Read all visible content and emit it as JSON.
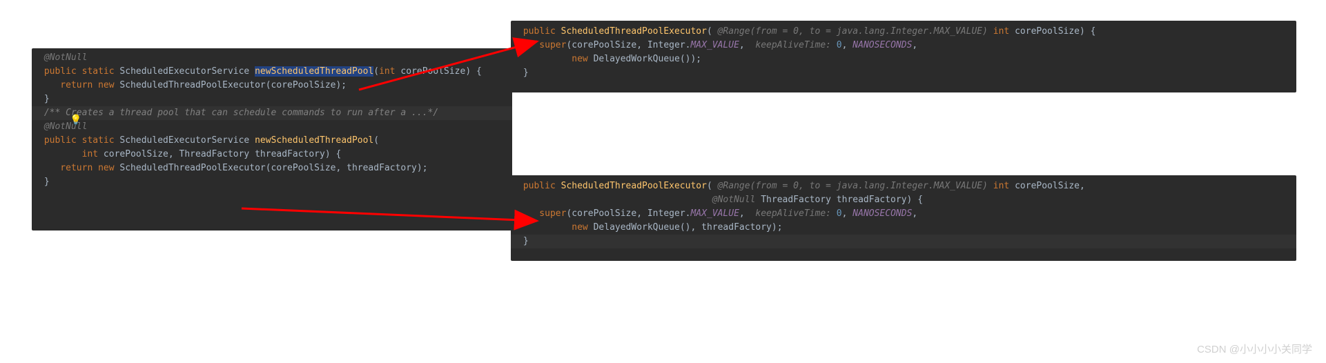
{
  "left": {
    "bulb_icon": "lightbulb-icon",
    "l0": "@NotNull",
    "l1a": "public",
    "l1b": "static",
    "l1c": "ScheduledExecutorService ",
    "l1d": "newScheduledThreadPool",
    "l1e": "(",
    "l1f": "int",
    "l1g": " corePoolSize) {",
    "l2a": "    return ",
    "l2b": "new ",
    "l2c": "ScheduledThreadPoolExecutor(corePoolSize);",
    "l3": "}",
    "l4": "",
    "l5": "/** Creates a thread pool that can schedule commands to run after a ...*/",
    "l6": " @NotNull",
    "l7a": "public ",
    "l7b": "static ",
    "l7c": "ScheduledExecutorService ",
    "l7d": "newScheduledThreadPool",
    "l7e": "(",
    "l8a": "        ",
    "l8b": "int",
    "l8c": " corePoolSize, ThreadFactory threadFactory) {",
    "l9a": "    return ",
    "l9b": "new ",
    "l9c": "ScheduledThreadPoolExecutor(corePoolSize, threadFactory);",
    "l10": "}"
  },
  "rtop": {
    "l1a": "public ",
    "l1b": "ScheduledThreadPoolExecutor",
    "l1c": "( ",
    "l1d": "@Range(from = 0, to = java.lang.Integer.MAX_VALUE)",
    "l1e": " int",
    "l1f": " corePoolSize) {",
    "l2a": "    super",
    "l2b": "(corePoolSize, Integer.",
    "l2c": "MAX_VALUE",
    "l2d": ",  ",
    "l2e": "keepAliveTime:",
    "l2f": " 0",
    "l2g": ", ",
    "l2h": "NANOSECONDS",
    "l2i": ",",
    "l3a": "          ",
    "l3b": "new ",
    "l3c": "DelayedWorkQueue());",
    "l4": "}"
  },
  "rbot": {
    "l1a": "public ",
    "l1b": "ScheduledThreadPoolExecutor",
    "l1c": "( ",
    "l1d": "@Range(from = 0, to = java.lang.Integer.MAX_VALUE)",
    "l1e": " int",
    "l1f": " corePoolSize,",
    "l2a": "                                    ",
    "l2b": "@NotNull",
    "l2c": " ThreadFactory threadFactory) {",
    "l3a": "    super",
    "l3b": "(corePoolSize, Integer.",
    "l3c": "MAX_VALUE",
    "l3d": ",  ",
    "l3e": "keepAliveTime:",
    "l3f": " 0",
    "l3g": ", ",
    "l3h": "NANOSECONDS",
    "l3i": ",",
    "l4a": "          ",
    "l4b": "new ",
    "l4c": "DelayedWorkQueue(), threadFactory);",
    "l5": "}"
  },
  "watermark": "CSDN @小小小小关同学"
}
